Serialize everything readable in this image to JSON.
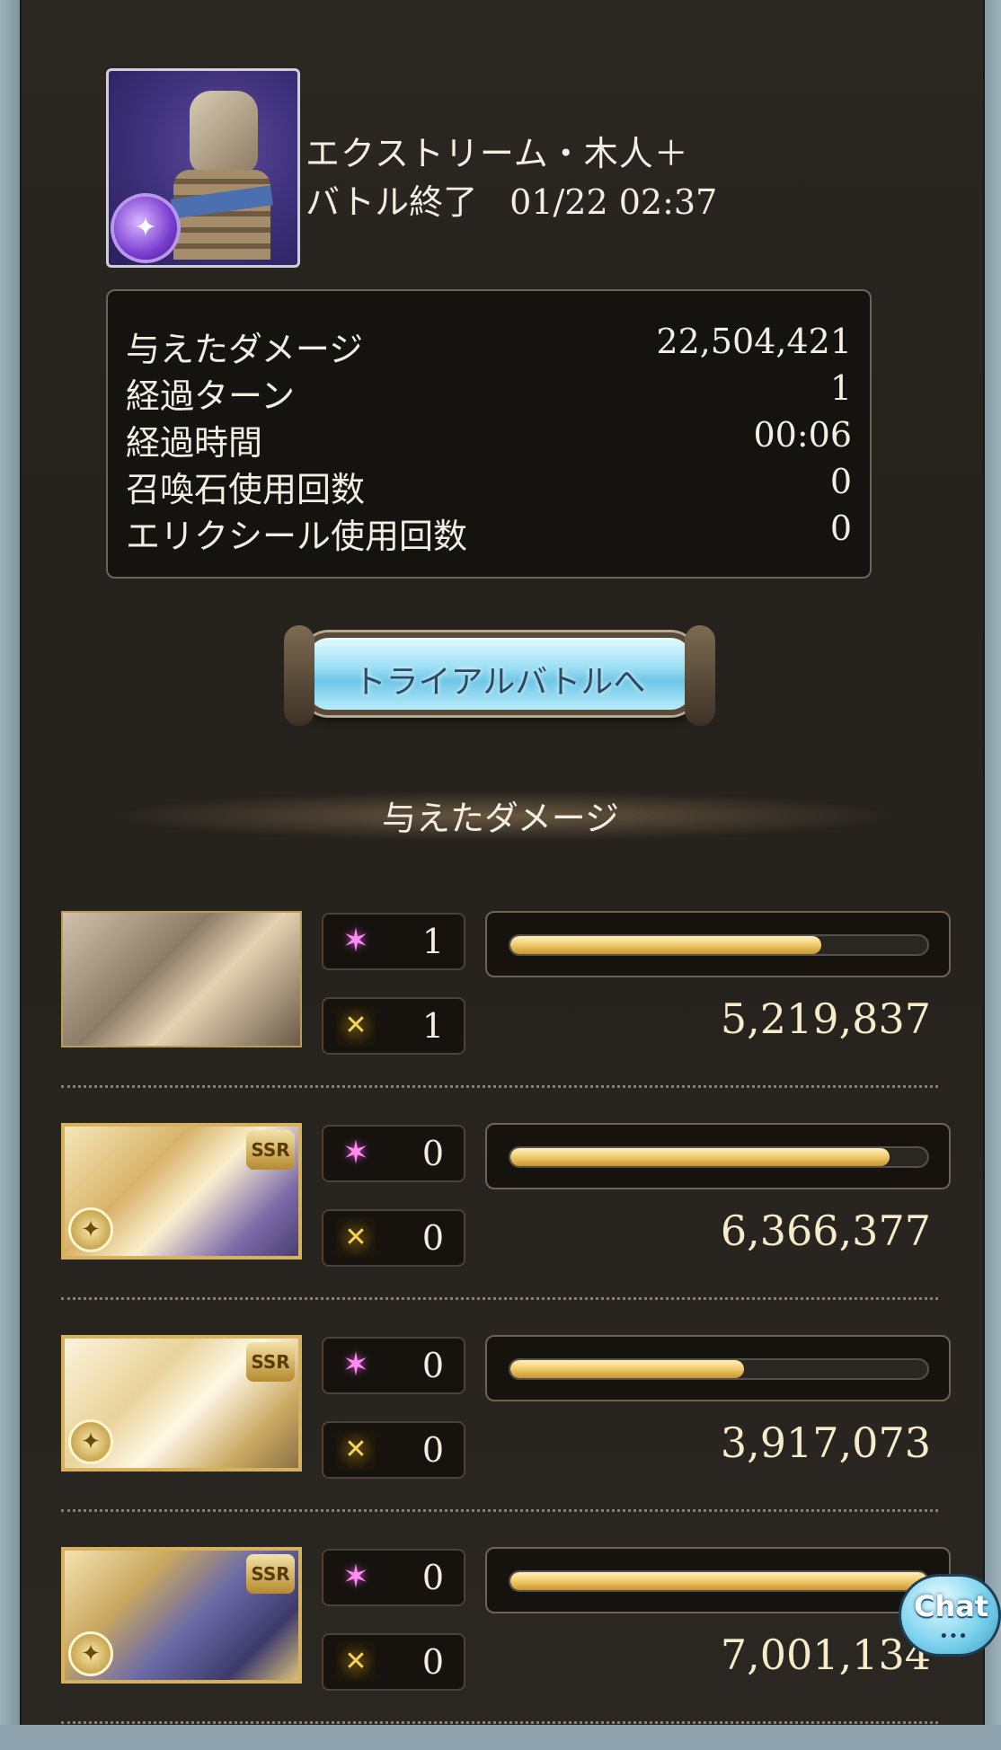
{
  "quest": {
    "title": "エクストリーム・木人＋",
    "status": "バトル終了",
    "time": "01/22 02:37",
    "element_icon": "dark-element-icon"
  },
  "stats": [
    {
      "label": "与えたダメージ",
      "value": "22,504,421"
    },
    {
      "label": "経過ターン",
      "value": "1"
    },
    {
      "label": "経過時間",
      "value": "00:06"
    },
    {
      "label": "召喚石使用回数",
      "value": "0"
    },
    {
      "label": "エリクシール使用回数",
      "value": "0"
    }
  ],
  "trial_button": {
    "label": "トライアルバトルへ"
  },
  "section_title": "与えたダメージ",
  "characters": [
    {
      "portrait": "main-character-portrait",
      "ssr": false,
      "ougi_count": "1",
      "skill_count": "1",
      "damage": "5,219,837",
      "damage_value": 5219837
    },
    {
      "portrait": "ssr-character-portrait",
      "ssr": true,
      "ssr_label": "SSR",
      "ougi_count": "0",
      "skill_count": "0",
      "damage": "6,366,377",
      "damage_value": 6366377
    },
    {
      "portrait": "ssr-character-portrait",
      "ssr": true,
      "ssr_label": "SSR",
      "ougi_count": "0",
      "skill_count": "0",
      "damage": "3,917,073",
      "damage_value": 3917073
    },
    {
      "portrait": "ssr-character-portrait",
      "ssr": true,
      "ssr_label": "SSR",
      "ougi_count": "0",
      "skill_count": "0",
      "damage": "7,001,134",
      "damage_value": 7001134
    }
  ],
  "chat_button": {
    "label": "Chat"
  },
  "colors": {
    "bar_fill": "#f3cf72",
    "panel": "#2a2621",
    "ougi_icon": "#ff8cf0",
    "skill_icon": "#f6d35c"
  }
}
